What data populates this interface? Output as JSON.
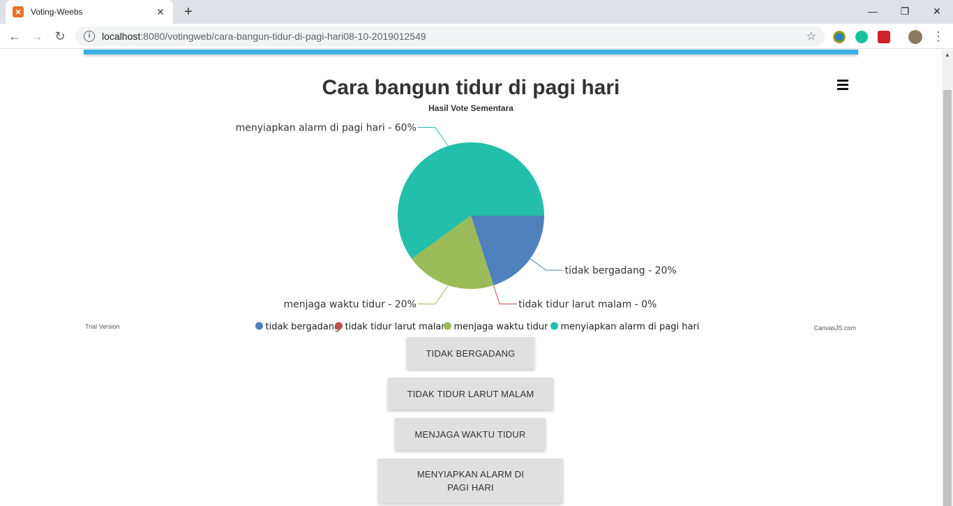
{
  "browser": {
    "tab_title": "Voting-Weebs",
    "url_host": "localhost",
    "url_path": ":8080/votingweb/cara-bangun-tidur-di-pagi-hari08-10-2019012549"
  },
  "chart_data": {
    "type": "pie",
    "title": "Cara bangun tidur di pagi hari",
    "subtitle": "Hasil Vote Sementara",
    "slices": [
      {
        "label": "tidak bergadang ",
        "value": 20,
        "color": "#4f81bc"
      },
      {
        "label": "tidak tidur larut malam",
        "value": 0,
        "color": "#c0504e"
      },
      {
        "label": "menjaga waktu tidur",
        "value": 20,
        "color": "#9bbb58"
      },
      {
        "label": "menyiapkan alarm di pagi hari",
        "value": 60,
        "color": "#23bfaa"
      }
    ],
    "index_labels": [
      "tidak bergadang  - 20%",
      "tidak tidur larut malam - 0%",
      "menjaga waktu tidur - 20%",
      "menyiapkan alarm di pagi hari - 60%"
    ],
    "legend": [
      "tidak bergadang",
      "tidak tidur larut malam",
      "menjaga waktu tidur",
      "menyiapkan alarm di pagi hari"
    ],
    "legend_position": "bottom",
    "trial_text": "Trial Version",
    "credit_text": "CanvasJS.com"
  },
  "buttons": [
    {
      "label": "TIDAK BERGADANG"
    },
    {
      "label": "TIDAK TIDUR LARUT MALAM"
    },
    {
      "label": "MENJAGA WAKTU TIDUR"
    },
    {
      "label": "MENYIAPKAN ALARM DI PAGI HARI"
    }
  ]
}
